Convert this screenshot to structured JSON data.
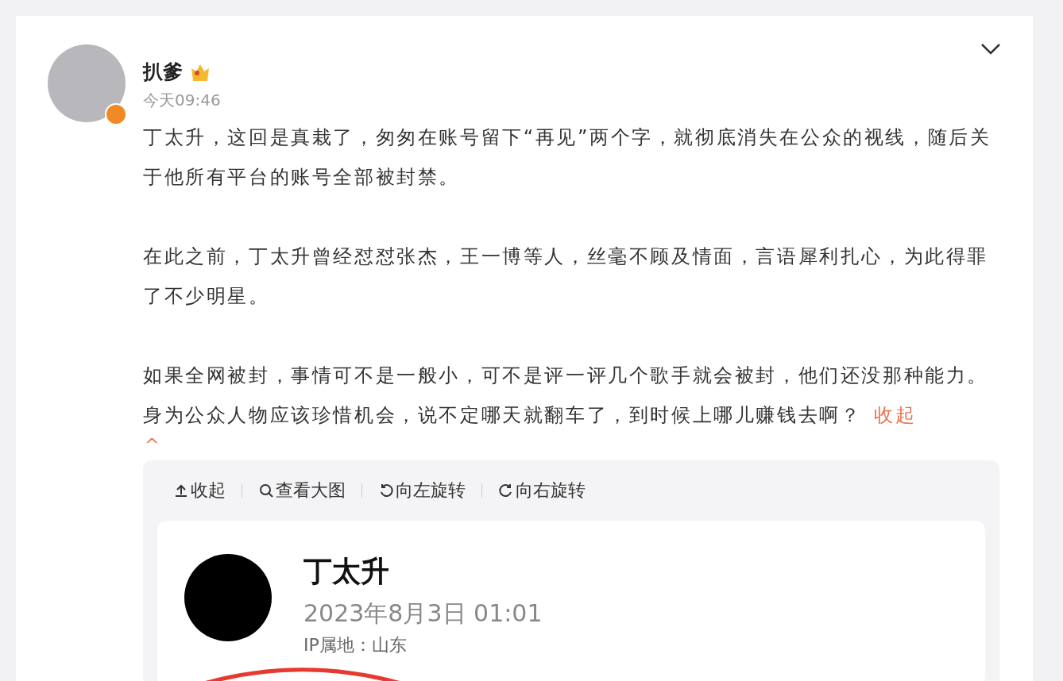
{
  "post": {
    "author": "扒爹",
    "time": "今天09:46",
    "verified": true,
    "paragraphs": [
      "丁太升，这回是真栽了，匆匆在账号留下“再见”两个字，就彻底消失在公众的视线，随后关于他所有平台的账号全部被封禁。",
      "在此之前，丁太升曾经怼怼张杰，王一博等人，丝毫不顾及情面，言语犀利扎心，为此得罪了不少明星。",
      "如果全网被封，事情可不是一般小，可不是评一评几个歌手就会被封，他们还没那种能力。身为公众人物应该珍惜机会，说不定哪天就翻车了，到时候上哪儿赚钱去啊？"
    ],
    "collapse_link": "收起",
    "collapse_caret": "^"
  },
  "viewer": {
    "toolbar": [
      {
        "kind": "collapse",
        "label": "收起"
      },
      {
        "kind": "zoom",
        "label": "查看大图"
      },
      {
        "kind": "rotate-left",
        "label": "向左旋转"
      },
      {
        "kind": "rotate-right",
        "label": "向右旋转"
      }
    ],
    "image": {
      "name": "丁太升",
      "date": "2023年8月3日 01:01",
      "location": "IP属地：山东"
    }
  }
}
